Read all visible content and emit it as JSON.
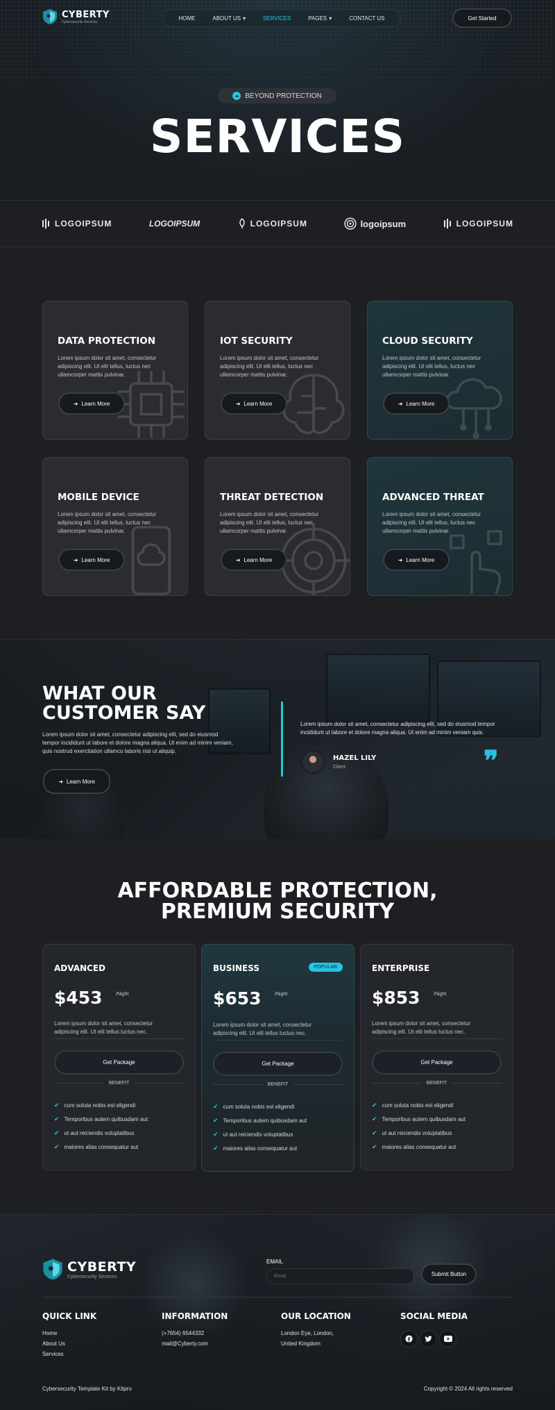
{
  "brand": {
    "name": "CYBERTY",
    "tagline": "Cybersecurity Services"
  },
  "nav": {
    "items": [
      {
        "label": "HOME",
        "active": false
      },
      {
        "label": "ABOUT US",
        "active": false,
        "dropdown": true
      },
      {
        "label": "SERVICES",
        "active": true
      },
      {
        "label": "PAGES",
        "active": false,
        "dropdown": true
      },
      {
        "label": "CONTACT US",
        "active": false
      }
    ],
    "cta": "Get Started"
  },
  "hero": {
    "pill": "BEYOND PROTECTION",
    "title": "SERVICES"
  },
  "logos": [
    "LOGOIPSUM",
    "LOGOIPSUM",
    "LOGOIPSUM",
    "logoipsum",
    "LOGOIPSUM"
  ],
  "services": [
    {
      "title": "DATA PROTECTION",
      "desc": "Lorem ipsum dolor sit amet, consectetur adipiscing elit. Ut elit tellus, luctus nec ullamcorper mattis pulvinar.",
      "button": "Learn More"
    },
    {
      "title": "IOT SECURITY",
      "desc": "Lorem ipsum dolor sit amet, consectetur adipiscing elit. Ut elit tellus, luctus nec ullamcorper mattis pulvinar.",
      "button": "Learn More"
    },
    {
      "title": "CLOUD SECURITY",
      "desc": "Lorem ipsum dolor sit amet, consectetur adipiscing elit. Ut elit tellus, luctus nec ullamcorper mattis pulvinar.",
      "button": "Learn More"
    },
    {
      "title": "MOBILE DEVICE",
      "desc": "Lorem ipsum dolor sit amet, consectetur adipiscing elit. Ut elit tellus, luctus nec ullamcorper mattis pulvinar.",
      "button": "Learn More"
    },
    {
      "title": "THREAT DETECTION",
      "desc": "Lorem ipsum dolor sit amet, consectetur adipiscing elit. Ut elit tellus, luctus nec ullamcorper mattis pulvinar.",
      "button": "Learn More"
    },
    {
      "title": "ADVANCED THREAT",
      "desc": "Lorem ipsum dolor sit amet, consectetur adipiscing elit. Ut elit tellus, luctus nec ullamcorper mattis pulvinar.",
      "button": "Learn More"
    }
  ],
  "testimonial": {
    "heading": "WHAT OUR CUSTOMER SAY",
    "text": "Lorem ipsum dolor sit amet, consectetur adipiscing elit, sed do eiusmod tempor incididunt ut labore et dolore magna aliqua. Ut enim ad minim veniam, quis nostrud exercitation ullamco laboris nisi ut aliquip.",
    "button": "Learn More",
    "quote": "Lorem ipsum dolor sit amet, consectetur adipiscing elit, sed do eiusmod tempor incididunt ut labore et dolore magna aliqua. Ut enim ad minim veniam quis.",
    "name": "HAZEL LILY",
    "role": "Client"
  },
  "pricing": {
    "heading": "AFFORDABLE PROTECTION, PREMIUM SECURITY",
    "plans": [
      {
        "name": "ADVANCED",
        "price": "$453",
        "per": "/Night",
        "desc": "Lorem ipsum dolor sit amet, consectetur adipiscing elit. Ut elit tellus luctus nec.",
        "button": "Get Package",
        "benefit": "BENEFIT",
        "features": [
          "cum soluta nobis est eligendi",
          "Temporibus autem quibusdam aut",
          "ut aut reiciendis voluptatibus",
          "maiores alias consequatur aut"
        ]
      },
      {
        "name": "BUSINESS",
        "badge": "POPULAR",
        "price": "$653",
        "per": "/Night",
        "desc": "Lorem ipsum dolor sit amet, consectetur adipiscing elit. Ut elit tellus luctus nec.",
        "button": "Get Package",
        "benefit": "BENEFIT",
        "features": [
          "cum soluta nobis est eligendi",
          "Temporibus autem quibusdam aut",
          "ut aut reiciendis voluptatibus",
          "maiores alias consequatur aut"
        ]
      },
      {
        "name": "ENTERPRISE",
        "price": "$853",
        "per": "/Night",
        "desc": "Lorem ipsum dolor sit amet, consectetur adipiscing elit. Ut elit tellus luctus nec.",
        "button": "Get Package",
        "benefit": "BENEFIT",
        "features": [
          "cum soluta nobis est eligendi",
          "Temporibus autem quibusdam aut",
          "ut aut reiciendis voluptatibus",
          "maiores alias consequatur aut"
        ]
      }
    ]
  },
  "footer": {
    "email_label": "EMAIL",
    "email_placeholder": "Email",
    "submit": "Submit Button",
    "quick_link": {
      "title": "QUICK LINK",
      "items": [
        "Home",
        "About Us",
        "Services"
      ]
    },
    "information": {
      "title": "INFORMATION",
      "items": [
        "(+7654) 6544332",
        "mail@Cyberty.com"
      ]
    },
    "location": {
      "title": "OUR LOCATION",
      "items": [
        "London Eye, London,",
        "United Kingdom"
      ]
    },
    "social": {
      "title": "SOCIAL MEDIA",
      "icons": [
        "facebook-icon",
        "twitter-icon",
        "youtube-icon"
      ]
    },
    "credit": "Cybersecurity Template Kit by Kitpro",
    "copyright": "Copyright © 2024 All rights reserved"
  },
  "colors": {
    "accent": "#25c6e2",
    "bg": "#1d1f23",
    "card": "#2a2c30",
    "card_teal": "#1f363c"
  }
}
